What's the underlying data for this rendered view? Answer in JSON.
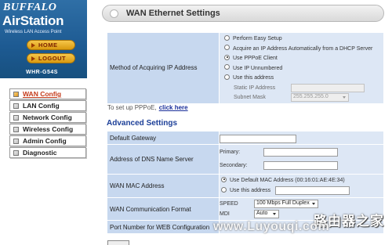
{
  "brand": {
    "buffalo": "BUFFALO",
    "airstation": "AirStation",
    "tagline": "Wireless LAN Access Point",
    "model": "WHR-G54S"
  },
  "sidebar_buttons": {
    "home": "HOME",
    "logout": "LOGOUT"
  },
  "nav": [
    {
      "label": "WAN Config",
      "active": true
    },
    {
      "label": "LAN Config",
      "active": false
    },
    {
      "label": "Network Config",
      "active": false
    },
    {
      "label": "Wireless Config",
      "active": false
    },
    {
      "label": "Admin Config",
      "active": false
    },
    {
      "label": "Diagnostic",
      "active": false
    }
  ],
  "page": {
    "title": "WAN Ethernet Settings"
  },
  "ip_method": {
    "label": "Method of Acquiring IP Address",
    "options": [
      "Perform Easy Setup",
      "Acquire an IP Address Automatically from a DHCP Server",
      "Use PPPoE Client",
      "Use IP Unnumbered",
      "Use this address"
    ],
    "selected": "Use PPPoE Client",
    "static_ip_label": "Static IP Address",
    "subnet_label": "Subnet Mask",
    "subnet_value": "255.255.255.0"
  },
  "pppoe_hint": {
    "text": "To set up PPPoE,",
    "link": "click here"
  },
  "advanced": {
    "heading": "Advanced Settings",
    "default_gateway_label": "Default Gateway",
    "dns_label": "Address of DNS Name Server",
    "dns_primary_label": "Primary:",
    "dns_secondary_label": "Secondary:",
    "mac_label": "WAN MAC Address",
    "mac_default_option": "Use Default MAC Address (00:16:01:AE:4E:34)",
    "mac_custom_option": "Use this address",
    "comm_label": "WAN Communication Format",
    "speed_label": "SPEED",
    "speed_value": "100 Mbps Full Duplex",
    "mdi_label": "MDI",
    "mdi_value": "Auto",
    "port_label": "Port Number for WEB Configuration"
  },
  "watermark": {
    "cn": "路由器之家",
    "url": "www.Luyouqi.com"
  }
}
